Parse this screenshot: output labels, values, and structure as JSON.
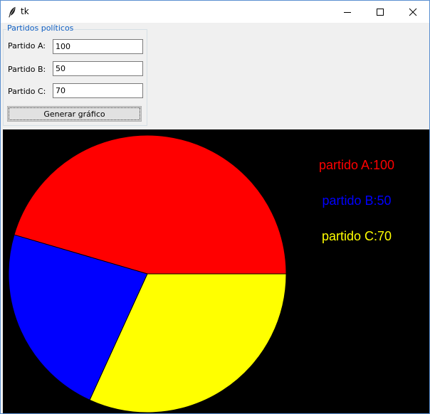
{
  "window": {
    "title": "tk",
    "icon": "feather-icon",
    "controls": [
      "minimize-icon",
      "maximize-icon",
      "close-icon"
    ]
  },
  "form": {
    "group_title": "Partidos políticos",
    "fields": [
      {
        "label": "Partido A:",
        "value": "100"
      },
      {
        "label": "Partido B:",
        "value": "50"
      },
      {
        "label": "Partido C:",
        "value": "70"
      }
    ],
    "button_label": "Generar gráfico"
  },
  "canvas": {
    "background": "#000000",
    "legend": [
      {
        "text": "partido A:100",
        "color": "#ff0000"
      },
      {
        "text": "partido B:50",
        "color": "#0000ff"
      },
      {
        "text": "partido C:70",
        "color": "#ffff00"
      }
    ]
  },
  "chart_data": {
    "type": "pie",
    "title": "",
    "categories": [
      "partido A",
      "partido B",
      "partido C"
    ],
    "values": [
      100,
      50,
      70
    ],
    "colors": [
      "#ff0000",
      "#0000ff",
      "#ffff00"
    ],
    "start_angle_deg": 0,
    "direction": "counterclockwise",
    "legend": "right"
  }
}
